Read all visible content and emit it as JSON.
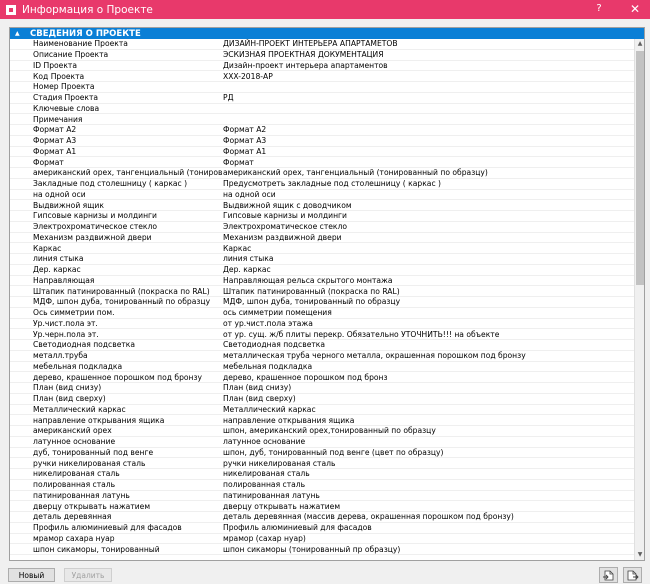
{
  "window": {
    "title": "Информация о Проекте",
    "help": "?",
    "close": "✕"
  },
  "section": {
    "title": "СВЕДЕНИЯ О ПРОЕКТЕ"
  },
  "rows": [
    {
      "k": "Наименование Проекта",
      "v": "ДИЗАЙН-ПРОЕКТ ИНТЕРЬЕРА АПАРТАМЕТОВ"
    },
    {
      "k": "Описание Проекта",
      "v": "ЭСКИЗНАЯ ПРОЕКТНАЯ ДОКУМЕНТАЦИЯ"
    },
    {
      "k": "ID Проекта",
      "v": "Дизайн-проект интерьера апартаментов"
    },
    {
      "k": "Код Проекта",
      "v": "XXX-2018-АР"
    },
    {
      "k": "Номер Проекта",
      "v": ""
    },
    {
      "k": "Стадия Проекта",
      "v": "РД"
    },
    {
      "k": "Ключевые слова",
      "v": ""
    },
    {
      "k": "Примечания",
      "v": ""
    },
    {
      "k": "Формат А2",
      "v": "Формат А2"
    },
    {
      "k": "Формат А3",
      "v": "Формат А3"
    },
    {
      "k": "Формат А1",
      "v": "Формат А1"
    },
    {
      "k": "Формат",
      "v": "Формат"
    },
    {
      "k": "американский орех, тангенциальный (тонированный по обра...",
      "v": "американский орех, тангенциальный (тонированный по образцу)"
    },
    {
      "k": "Закладные под столешницу ( каркас )",
      "v": "Предусмотреть закладные под столешницу ( каркас )"
    },
    {
      "k": "на одной оси",
      "v": "на одной оси"
    },
    {
      "k": "Выдвижной ящик",
      "v": "Выдвижной ящик с доводчиком"
    },
    {
      "k": "Гипсовые карнизы и молдинги",
      "v": "Гипсовые карнизы и молдинги"
    },
    {
      "k": "Электрохроматическое стекло",
      "v": "Электрохроматическое стекло"
    },
    {
      "k": "Механизм раздвижной двери",
      "v": "Механизм раздвижной двери"
    },
    {
      "k": "Каркас",
      "v": "Каркас"
    },
    {
      "k": "линия стыка",
      "v": "линия стыка"
    },
    {
      "k": "Дер. каркас",
      "v": "Дер. каркас"
    },
    {
      "k": "Направляющая",
      "v": "Направляющая рельса скрытого монтажа"
    },
    {
      "k": "Штапик патинированный (покраска по RAL)",
      "v": "Штапик патинированный (покраска по RAL)"
    },
    {
      "k": "МДФ, шпон дуба, тонированный по образцу",
      "v": "МДФ, шпон дуба, тонированный по образцу"
    },
    {
      "k": "Ось симметрии пом.",
      "v": "ось симметрии помещения"
    },
    {
      "k": "Ур.чист.пола эт.",
      "v": "от ур.чист.пола этажа"
    },
    {
      "k": "Ур.черн.пола эт.",
      "v": "от ур. сущ. ж/б плиты перекр.  Обязательно УТОЧНИТЬ!!! на объекте"
    },
    {
      "k": "Светодиодная подсветка",
      "v": "Светодиодная подсветка"
    },
    {
      "k": "металл.труба",
      "v": "металлическая труба черного металла,  окрашенная порошком под бронзу"
    },
    {
      "k": "мебельная подкладка",
      "v": "мебельная подкладка"
    },
    {
      "k": "дерево, крашенное порошком под бронзу",
      "v": "дерево, крашенное порошком под бронз"
    },
    {
      "k": "План (вид снизу)",
      "v": "План (вид снизу)"
    },
    {
      "k": "План (вид сверху)",
      "v": "План (вид сверху)"
    },
    {
      "k": "Металлический каркас",
      "v": "Металлический каркас"
    },
    {
      "k": "направление открывания ящика",
      "v": "направление открывания ящика"
    },
    {
      "k": "американский орех",
      "v": "шпон, американский орех,тонированный по образцу"
    },
    {
      "k": "латунное основание",
      "v": "латунное основание"
    },
    {
      "k": "дуб, тонированный под венге",
      "v": "шпон, дуб, тонированный под венге (цвет по образцу)"
    },
    {
      "k": "ручки никелированая сталь",
      "v": "ручки никелированая сталь"
    },
    {
      "k": "никелированая сталь",
      "v": "никелированая сталь"
    },
    {
      "k": "полированная сталь",
      "v": "полированная сталь"
    },
    {
      "k": "патинированная латунь",
      "v": "патинированная латунь"
    },
    {
      "k": "дверцу открывать нажатием",
      "v": "дверцу открывать нажатием"
    },
    {
      "k": "деталь деревянная",
      "v": "деталь деревянная (массив дерева, окрашенная порошком под бронзу)"
    },
    {
      "k": "Профиль алюминиевый для фасадов",
      "v": "Профиль алюминиевый для фасадов"
    },
    {
      "k": "мрамор сахара нуар",
      "v": "мрамор (сахар нуар)"
    },
    {
      "k": "шпон сикаморы, тонированный",
      "v": "шпон сикаморы (тонированный пр образцу)"
    }
  ],
  "footer": {
    "new_label": "Новый",
    "delete_label": "Удалить"
  },
  "colors": {
    "titlebar": "#e8396b",
    "section_header": "#0a7fd6"
  },
  "icons": {
    "import": "import-file-icon",
    "export": "export-file-icon"
  }
}
